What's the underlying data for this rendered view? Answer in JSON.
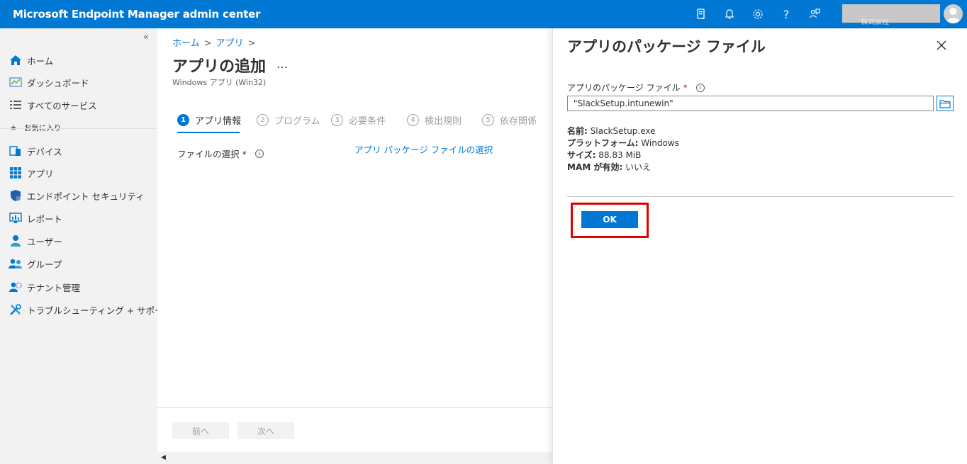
{
  "header": {
    "title": "Microsoft Endpoint Manager admin center",
    "account_tenant": "株式会社",
    "icons": [
      "device-icon",
      "bell-icon",
      "gear-icon",
      "help-icon",
      "feedback-icon",
      "avatar"
    ]
  },
  "sidebar": {
    "collapse_glyph": "«",
    "favorites_label": "お気に入り",
    "items": [
      {
        "label": "ホーム",
        "icon": "home-icon"
      },
      {
        "label": "ダッシュボード",
        "icon": "dashboard-icon"
      },
      {
        "label": "すべてのサービス",
        "icon": "list-icon"
      },
      {
        "label": "デバイス",
        "icon": "devices-icon"
      },
      {
        "label": "アプリ",
        "icon": "apps-icon"
      },
      {
        "label": "エンドポイント セキュリティ",
        "icon": "shield-icon"
      },
      {
        "label": "レポート",
        "icon": "report-icon"
      },
      {
        "label": "ユーザー",
        "icon": "user-icon"
      },
      {
        "label": "グループ",
        "icon": "group-icon"
      },
      {
        "label": "テナント管理",
        "icon": "tenant-icon"
      },
      {
        "label": "トラブルシューティング + サポート",
        "icon": "wrench-icon"
      }
    ]
  },
  "main": {
    "breadcrumb": [
      "ホーム",
      "アプリ"
    ],
    "title": "アプリの追加",
    "more": "…",
    "subtitle": "Windows アプリ (Win32)",
    "steps": [
      {
        "num": "1",
        "label": "アプリ情報",
        "active": true
      },
      {
        "num": "2",
        "label": "プログラム",
        "active": false
      },
      {
        "num": "3",
        "label": "必要条件",
        "active": false
      },
      {
        "num": "4",
        "label": "検出規則",
        "active": false
      },
      {
        "num": "5",
        "label": "依存関係",
        "active": false
      }
    ],
    "file_select_label": "ファイルの選択 *",
    "file_select_link": "アプリ パッケージ ファイルの選択",
    "prev_button": "前へ",
    "next_button": "次へ"
  },
  "panel": {
    "title": "アプリのパッケージ ファイル",
    "field_label": "アプリのパッケージ ファイル",
    "required_mark": "*",
    "field_value": "\"SlackSetup.intunewin\"",
    "details": [
      {
        "key": "名前:",
        "value": "SlackSetup.exe"
      },
      {
        "key": "プラットフォーム:",
        "value": "Windows"
      },
      {
        "key": "サイズ:",
        "value": "88.83 MiB"
      },
      {
        "key": "MAM が有効:",
        "value": "いいえ"
      }
    ],
    "ok_button": "OK"
  },
  "colors": {
    "brand_blue": "#0078d4",
    "highlight_red": "#e00000",
    "sidebar_bg": "#f2f2f2"
  }
}
